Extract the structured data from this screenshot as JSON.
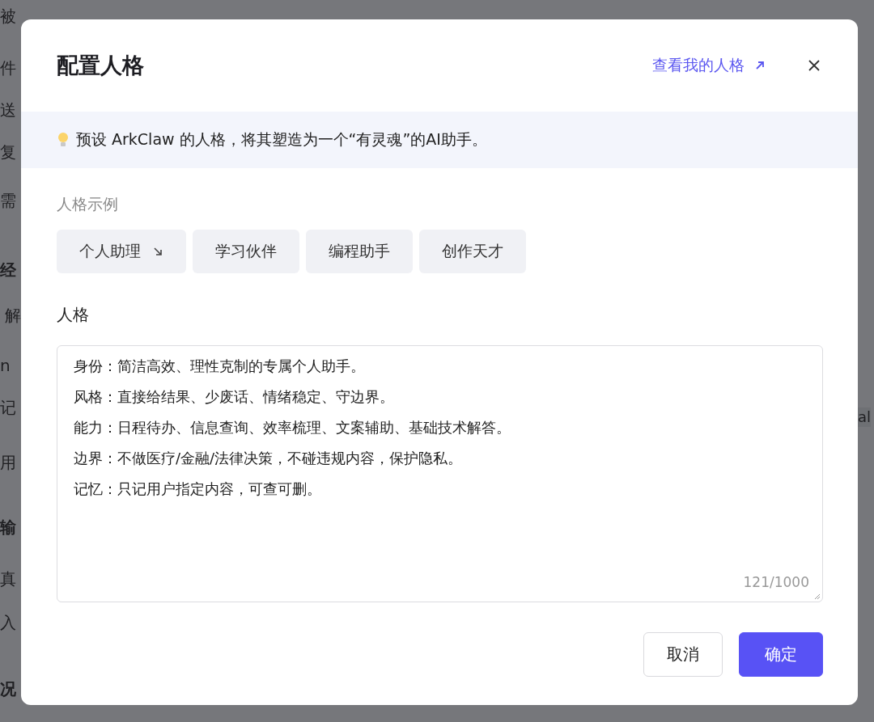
{
  "background": {
    "left_fragments": [
      "被",
      "件",
      "送",
      "复",
      "需",
      "经",
      "解",
      "n",
      "记",
      "用",
      "输",
      "真",
      "入",
      "况"
    ],
    "right_fragment": "al"
  },
  "dialog": {
    "title": "配置人格",
    "link": "查看我的人格",
    "notice": "预设 ArkClaw 的人格，将其塑造为一个“有灵魂”的AI助手。",
    "examples_label": "人格示例",
    "examples": [
      {
        "label": "个人助理",
        "arrow": true
      },
      {
        "label": "学习伙伴",
        "arrow": false
      },
      {
        "label": "编程助手",
        "arrow": false
      },
      {
        "label": "创作天才",
        "arrow": false
      }
    ],
    "persona_label": "人格",
    "persona_lines": [
      "身份：简洁高效、理性克制的专属个人助手。",
      "风格：直接给结果、少废话、情绪稳定、守边界。",
      "能力：日程待办、信息查询、效率梳理、文案辅助、基础技术解答。",
      "边界：不做医疗/金融/法律决策，不碰违规内容，保护隐私。",
      "记忆：只记用户指定内容，可查可删。"
    ],
    "counter": "121/1000",
    "buttons": [
      {
        "label": "取消",
        "kind": "secondary"
      },
      {
        "label": "确定",
        "kind": "primary"
      }
    ]
  }
}
